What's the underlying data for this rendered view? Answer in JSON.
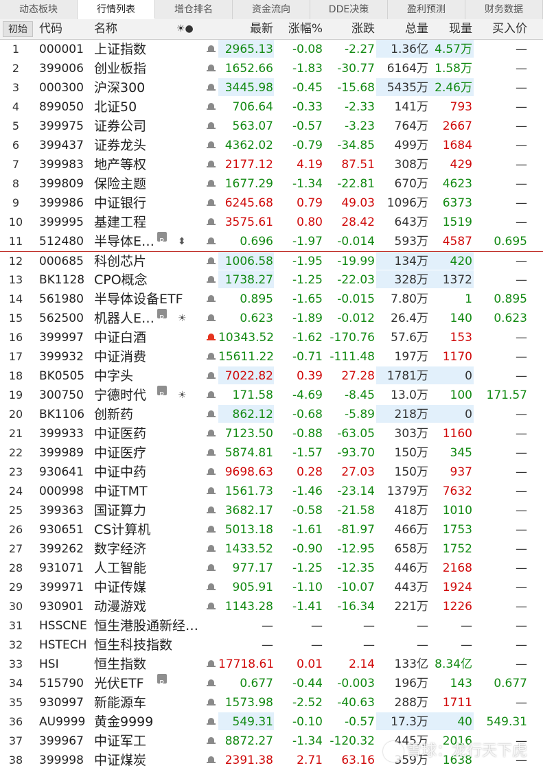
{
  "tabs": [
    "动态板块",
    "行情列表",
    "增仓排名",
    "资金流向",
    "DDE决策",
    "盈利预测",
    "财务数据"
  ],
  "active_tab": 1,
  "header": {
    "init": "初始",
    "code": "代码",
    "name": "名称",
    "icons": "☀●",
    "last": "最新",
    "pct": "涨幅%",
    "chg": "涨跌",
    "vol": "总量",
    "cur": "现量",
    "buy": "买入价"
  },
  "watermark": "雪球：龙行天下虎",
  "colors": {
    "up": "#d00a0a",
    "down": "#138a13",
    "highlight": "#e2f0fb",
    "separator": "#c0302a"
  },
  "rows": [
    {
      "idx": "1",
      "code": "000001",
      "name": "上证指数",
      "last": "2965.13",
      "pct": "-0.08",
      "chg": "-2.27",
      "vol": "1.36亿",
      "cur": "4.57万",
      "buy": "—",
      "dir": "g",
      "cur_dir": "g",
      "hl_last": true,
      "hl_vol": true
    },
    {
      "idx": "2",
      "code": "399006",
      "name": "创业板指",
      "last": "1652.66",
      "pct": "-1.83",
      "chg": "-30.77",
      "vol": "6164万",
      "cur": "1.58万",
      "buy": "—",
      "dir": "g",
      "cur_dir": "g"
    },
    {
      "idx": "3",
      "code": "000300",
      "name": "沪深300",
      "last": "3445.98",
      "pct": "-0.45",
      "chg": "-15.68",
      "vol": "5435万",
      "cur": "2.46万",
      "buy": "—",
      "dir": "g",
      "cur_dir": "g",
      "hl_last": true,
      "hl_vol": true
    },
    {
      "idx": "4",
      "code": "899050",
      "name": "北证50",
      "last": "706.64",
      "pct": "-0.33",
      "chg": "-2.33",
      "vol": "141万",
      "cur": "793",
      "buy": "—",
      "dir": "g",
      "cur_dir": "r"
    },
    {
      "idx": "5",
      "code": "399975",
      "name": "证券公司",
      "last": "563.07",
      "pct": "-0.57",
      "chg": "-3.23",
      "vol": "764万",
      "cur": "2667",
      "buy": "—",
      "dir": "g",
      "cur_dir": "r"
    },
    {
      "idx": "6",
      "code": "399437",
      "name": "证券龙头",
      "last": "4362.02",
      "pct": "-0.79",
      "chg": "-34.85",
      "vol": "499万",
      "cur": "1684",
      "buy": "—",
      "dir": "g",
      "cur_dir": "r"
    },
    {
      "idx": "7",
      "code": "399983",
      "name": "地产等权",
      "last": "2177.12",
      "pct": "4.19",
      "chg": "87.51",
      "vol": "308万",
      "cur": "429",
      "buy": "—",
      "dir": "r",
      "cur_dir": "r"
    },
    {
      "idx": "8",
      "code": "399809",
      "name": "保险主题",
      "last": "1677.29",
      "pct": "-1.34",
      "chg": "-22.81",
      "vol": "670万",
      "cur": "4623",
      "buy": "—",
      "dir": "g",
      "cur_dir": "g"
    },
    {
      "idx": "9",
      "code": "399986",
      "name": "中证银行",
      "last": "6245.68",
      "pct": "0.79",
      "chg": "49.03",
      "vol": "1096万",
      "cur": "6373",
      "buy": "—",
      "dir": "r",
      "cur_dir": "g"
    },
    {
      "idx": "10",
      "code": "399995",
      "name": "基建工程",
      "last": "3575.61",
      "pct": "0.80",
      "chg": "28.42",
      "vol": "643万",
      "cur": "1519",
      "buy": "—",
      "dir": "r",
      "cur_dir": "g"
    },
    {
      "idx": "11",
      "code": "512480",
      "name": "半导体E…",
      "badge": "R",
      "sym": "⬍",
      "last": "0.696",
      "pct": "-1.97",
      "chg": "-0.014",
      "vol": "593万",
      "cur": "4587",
      "buy": "0.695",
      "dir": "g",
      "cur_dir": "r"
    },
    {
      "idx": "12",
      "code": "000685",
      "name": "科创芯片",
      "last": "1006.58",
      "pct": "-1.95",
      "chg": "-19.99",
      "vol": "134万",
      "cur": "420",
      "buy": "—",
      "dir": "g",
      "cur_dir": "g",
      "hl_last": true,
      "hl_vol": true,
      "sep": true
    },
    {
      "idx": "13",
      "code": "BK1128",
      "name": "CPO概念",
      "last": "1738.27",
      "pct": "-1.25",
      "chg": "-22.03",
      "vol": "328万",
      "cur": "1372",
      "buy": "—",
      "dir": "g",
      "cur_dir": "k",
      "hl_last": true,
      "hl_vol": true
    },
    {
      "idx": "14",
      "code": "561980",
      "name": "半导体设备ETF",
      "last": "0.895",
      "pct": "-1.65",
      "chg": "-0.015",
      "vol": "7.80万",
      "cur": "1",
      "buy": "0.895",
      "dir": "g",
      "cur_dir": "g"
    },
    {
      "idx": "15",
      "code": "562500",
      "name": "机器人E…",
      "badge": "R",
      "sym": "☀",
      "last": "0.623",
      "pct": "-1.89",
      "chg": "-0.012",
      "vol": "26.4万",
      "cur": "140",
      "buy": "0.623",
      "dir": "g",
      "cur_dir": "g"
    },
    {
      "idx": "16",
      "code": "399997",
      "name": "中证白酒",
      "last": "10343.52",
      "pct": "-1.62",
      "chg": "-170.76",
      "vol": "57.6万",
      "cur": "153",
      "buy": "—",
      "dir": "g",
      "cur_dir": "r",
      "hot": true
    },
    {
      "idx": "17",
      "code": "399932",
      "name": "中证消费",
      "last": "15611.22",
      "pct": "-0.71",
      "chg": "-111.48",
      "vol": "197万",
      "cur": "1170",
      "buy": "—",
      "dir": "g",
      "cur_dir": "r"
    },
    {
      "idx": "18",
      "code": "BK0505",
      "name": "中字头",
      "last": "7022.82",
      "pct": "0.39",
      "chg": "27.28",
      "vol": "1781万",
      "cur": "0",
      "buy": "—",
      "dir": "r",
      "cur_dir": "k",
      "hl_last": true,
      "hl_vol": true
    },
    {
      "idx": "19",
      "code": "300750",
      "name": "宁德时代",
      "badge": "R",
      "sym": "☀",
      "last": "171.58",
      "pct": "-4.69",
      "chg": "-8.45",
      "vol": "13.0万",
      "cur": "100",
      "buy": "171.57",
      "dir": "g",
      "cur_dir": "g"
    },
    {
      "idx": "20",
      "code": "BK1106",
      "name": "创新药",
      "last": "862.12",
      "pct": "-0.68",
      "chg": "-5.89",
      "vol": "218万",
      "cur": "0",
      "buy": "—",
      "dir": "g",
      "cur_dir": "k",
      "hl_last": true,
      "hl_vol": true
    },
    {
      "idx": "21",
      "code": "399933",
      "name": "中证医药",
      "last": "7123.50",
      "pct": "-0.88",
      "chg": "-63.05",
      "vol": "303万",
      "cur": "1160",
      "buy": "—",
      "dir": "g",
      "cur_dir": "r"
    },
    {
      "idx": "22",
      "code": "399989",
      "name": "中证医疗",
      "last": "5874.81",
      "pct": "-1.57",
      "chg": "-93.70",
      "vol": "150万",
      "cur": "345",
      "buy": "—",
      "dir": "g",
      "cur_dir": "g"
    },
    {
      "idx": "23",
      "code": "930641",
      "name": "中证中药",
      "last": "9698.63",
      "pct": "0.28",
      "chg": "27.03",
      "vol": "150万",
      "cur": "937",
      "buy": "—",
      "dir": "r",
      "cur_dir": "r"
    },
    {
      "idx": "24",
      "code": "000998",
      "name": "中证TMT",
      "last": "1561.73",
      "pct": "-1.46",
      "chg": "-23.14",
      "vol": "1379万",
      "cur": "7632",
      "buy": "—",
      "dir": "g",
      "cur_dir": "r"
    },
    {
      "idx": "25",
      "code": "399363",
      "name": "国证算力",
      "last": "3682.17",
      "pct": "-0.58",
      "chg": "-21.58",
      "vol": "418万",
      "cur": "1010",
      "buy": "—",
      "dir": "g",
      "cur_dir": "g"
    },
    {
      "idx": "26",
      "code": "930651",
      "name": "CS计算机",
      "last": "5013.18",
      "pct": "-1.61",
      "chg": "-81.97",
      "vol": "466万",
      "cur": "1753",
      "buy": "—",
      "dir": "g",
      "cur_dir": "g"
    },
    {
      "idx": "27",
      "code": "399262",
      "name": "数字经济",
      "last": "1433.52",
      "pct": "-0.90",
      "chg": "-12.95",
      "vol": "658万",
      "cur": "1752",
      "buy": "—",
      "dir": "g",
      "cur_dir": "g"
    },
    {
      "idx": "28",
      "code": "931071",
      "name": "人工智能",
      "last": "977.17",
      "pct": "-1.25",
      "chg": "-12.35",
      "vol": "446万",
      "cur": "2168",
      "buy": "—",
      "dir": "g",
      "cur_dir": "r"
    },
    {
      "idx": "29",
      "code": "399971",
      "name": "中证传媒",
      "last": "905.91",
      "pct": "-1.10",
      "chg": "-10.07",
      "vol": "443万",
      "cur": "1924",
      "buy": "—",
      "dir": "g",
      "cur_dir": "r"
    },
    {
      "idx": "30",
      "code": "930901",
      "name": "动漫游戏",
      "last": "1143.28",
      "pct": "-1.41",
      "chg": "-16.34",
      "vol": "221万",
      "cur": "1226",
      "buy": "—",
      "dir": "g",
      "cur_dir": "r"
    },
    {
      "idx": "31",
      "code": "HSSCNE",
      "name": "恒生港股通新经…",
      "last": "—",
      "pct": "—",
      "chg": "—",
      "vol": "—",
      "cur": "—",
      "buy": "—",
      "dir": "k",
      "cur_dir": "k",
      "nobell": true
    },
    {
      "idx": "32",
      "code": "HSTECH",
      "name": "恒生科技指数",
      "last": "—",
      "pct": "—",
      "chg": "—",
      "vol": "—",
      "cur": "—",
      "buy": "—",
      "dir": "k",
      "cur_dir": "k",
      "nobell": true
    },
    {
      "idx": "33",
      "code": "HSI",
      "name": "恒生指数",
      "last": "17718.61",
      "pct": "0.01",
      "chg": "2.14",
      "vol": "133亿",
      "cur": "8.34亿",
      "buy": "—",
      "dir": "r",
      "cur_dir": "g"
    },
    {
      "idx": "34",
      "code": "515790",
      "name": "光伏ETF",
      "badge": "R",
      "last": "0.677",
      "pct": "-0.44",
      "chg": "-0.003",
      "vol": "196万",
      "cur": "143",
      "buy": "0.677",
      "dir": "g",
      "cur_dir": "g"
    },
    {
      "idx": "35",
      "code": "930997",
      "name": "新能源车",
      "last": "1573.98",
      "pct": "-2.52",
      "chg": "-40.63",
      "vol": "288万",
      "cur": "1711",
      "buy": "—",
      "dir": "g",
      "cur_dir": "r"
    },
    {
      "idx": "36",
      "code": "AU9999",
      "name": "黄金9999",
      "last": "549.31",
      "pct": "-0.10",
      "chg": "-0.57",
      "vol": "17.3万",
      "cur": "40",
      "buy": "549.31",
      "dir": "g",
      "cur_dir": "g",
      "hl_last": true,
      "hl_vol": true
    },
    {
      "idx": "37",
      "code": "399967",
      "name": "中证军工",
      "last": "8872.27",
      "pct": "-1.34",
      "chg": "-120.32",
      "vol": "445万",
      "cur": "2016",
      "buy": "—",
      "dir": "g",
      "cur_dir": "g"
    },
    {
      "idx": "38",
      "code": "399998",
      "name": "中证煤炭",
      "last": "2391.38",
      "pct": "2.71",
      "chg": "63.16",
      "vol": "359万",
      "cur": "1638",
      "buy": "—",
      "dir": "r",
      "cur_dir": "g"
    }
  ]
}
